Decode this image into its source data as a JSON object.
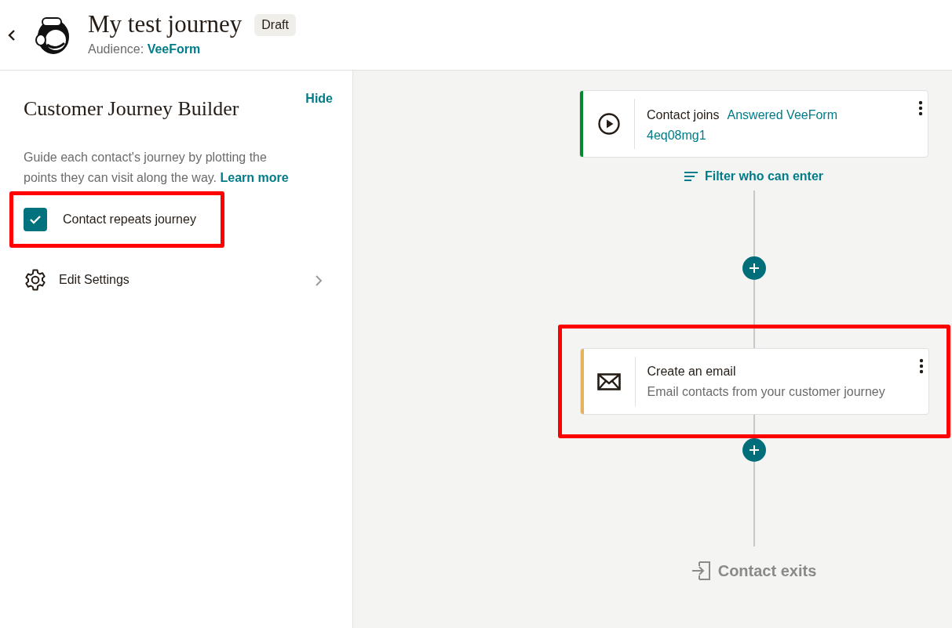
{
  "header": {
    "title": "My test journey",
    "status": "Draft",
    "audience_label": "Audience:",
    "audience": "VeeForm"
  },
  "sidebar": {
    "title": "Customer Journey Builder",
    "hide": "Hide",
    "description": "Guide each contact's journey by plotting the points they can visit along the way.",
    "learn_more": "Learn more",
    "repeat": {
      "label": "Contact repeats journey",
      "checked": true,
      "highlighted": true
    },
    "settings": {
      "label": "Edit Settings"
    }
  },
  "canvas": {
    "steps": [
      {
        "kind": "trigger",
        "title": "Contact joins",
        "detail": "Answered VeeForm",
        "form_id": "4eq08mg1",
        "color": "#00892f",
        "highlighted": false
      },
      {
        "kind": "filter",
        "label": "Filter who can enter"
      },
      {
        "kind": "add"
      },
      {
        "kind": "action",
        "title": "Create an email",
        "detail": "Email contacts from your customer journey",
        "color": "#e6b35c",
        "highlighted": true
      },
      {
        "kind": "add"
      },
      {
        "kind": "exit",
        "label": "Contact exits"
      }
    ]
  }
}
